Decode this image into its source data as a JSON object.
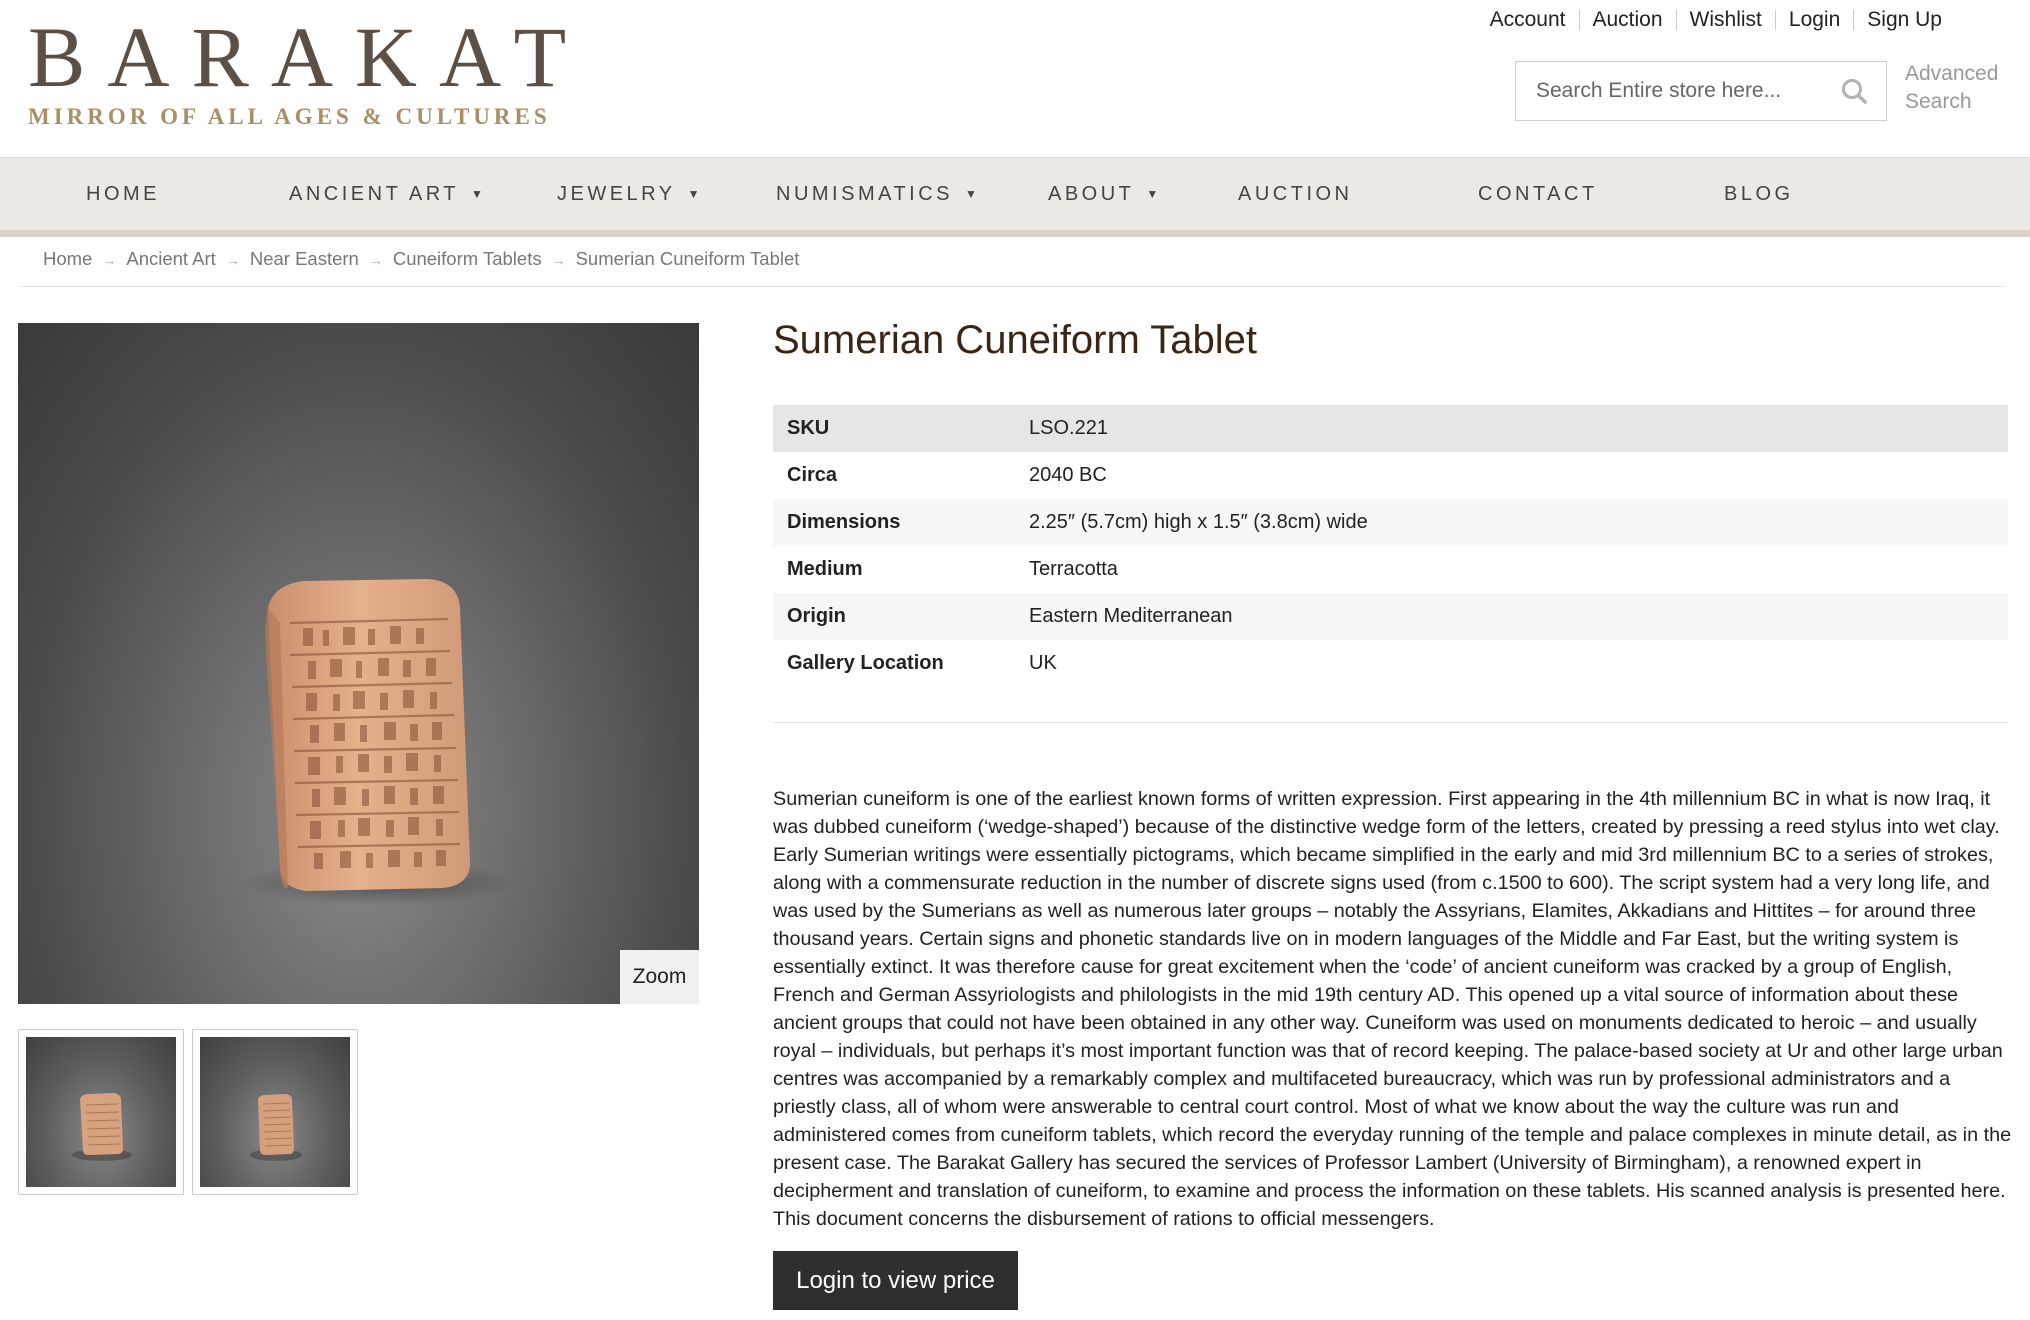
{
  "logo": {
    "title": "BARAKAT",
    "tagline": "MIRROR OF ALL AGES & CULTURES"
  },
  "top_links": [
    "Account",
    "Auction",
    "Wishlist",
    "Login",
    "Sign Up"
  ],
  "search": {
    "placeholder": "Search Entire store here...",
    "advanced_line1": "Advanced",
    "advanced_line2": "Search"
  },
  "nav": {
    "items": [
      {
        "label": "HOME",
        "dropdown": false
      },
      {
        "label": "ANCIENT ART",
        "dropdown": true
      },
      {
        "label": "JEWELRY",
        "dropdown": true
      },
      {
        "label": "NUMISMATICS",
        "dropdown": true
      },
      {
        "label": "ABOUT",
        "dropdown": true
      },
      {
        "label": "AUCTION",
        "dropdown": false
      },
      {
        "label": "CONTACT",
        "dropdown": false
      },
      {
        "label": "BLOG",
        "dropdown": false
      }
    ]
  },
  "breadcrumb": [
    "Home",
    "Ancient Art",
    "Near Eastern",
    "Cuneiform Tablets",
    "Sumerian Cuneiform Tablet"
  ],
  "gallery": {
    "zoom_label": "Zoom"
  },
  "product": {
    "title": "Sumerian Cuneiform Tablet",
    "attributes": [
      {
        "key": "SKU",
        "value": "LSO.221"
      },
      {
        "key": "Circa",
        "value": "2040 BC"
      },
      {
        "key": "Dimensions",
        "value": "2.25″ (5.7cm) high x 1.5″ (3.8cm) wide"
      },
      {
        "key": "Medium",
        "value": "Terracotta"
      },
      {
        "key": "Origin",
        "value": "Eastern Mediterranean"
      },
      {
        "key": "Gallery Location",
        "value": "UK"
      }
    ],
    "description": "Sumerian cuneiform is one of the earliest known forms of written expression. First appearing in the 4th millennium BC in what is now Iraq, it was dubbed cuneiform (‘wedge-shaped’) because of the distinctive wedge form of the letters, created by pressing a reed stylus into wet clay. Early Sumerian writings were essentially pictograms, which became simplified in the early and mid 3rd millennium BC to a series of strokes, along with a commensurate reduction in the number of discrete signs used (from c.1500 to 600). The script system had a very long life, and was used by the Sumerians as well as numerous later groups – notably the Assyrians, Elamites, Akkadians and Hittites – for around three thousand years. Certain signs and phonetic standards live on in modern languages of the Middle and Far East, but the writing system is essentially extinct. It was therefore cause for great excitement when the ‘code’ of ancient cuneiform was cracked by a group of English, French and German Assyriologists and philologists in the mid 19th century AD. This opened up a vital source of information about these ancient groups that could not have been obtained in any other way. Cuneiform was used on monuments dedicated to heroic – and usually royal – individuals, but perhaps it’s most important function was that of record keeping. The palace-based society at Ur and other large urban centres was accompanied by a remarkably complex and multifaceted bureaucracy, which was run by professional administrators and a priestly class, all of whom were answerable to central court control. Most of what we know about the way the culture was run and administered comes from cuneiform tablets, which record the everyday running of the temple and palace complexes in minute detail, as in the present case. The Barakat Gallery has secured the services of Professor Lambert (University of Birmingham), a renowned expert in decipherment and translation of cuneiform, to examine and process the information on these tablets. His scanned analysis is presented here. This document concerns the disbursement of rations to official messengers.",
    "login_button": "Login to view price"
  },
  "colors": {
    "nav_bg": "#ece9e4",
    "title_brown": "#3a2415",
    "logo_gold": "#a78f68",
    "button_dark": "#2f2f2f"
  }
}
